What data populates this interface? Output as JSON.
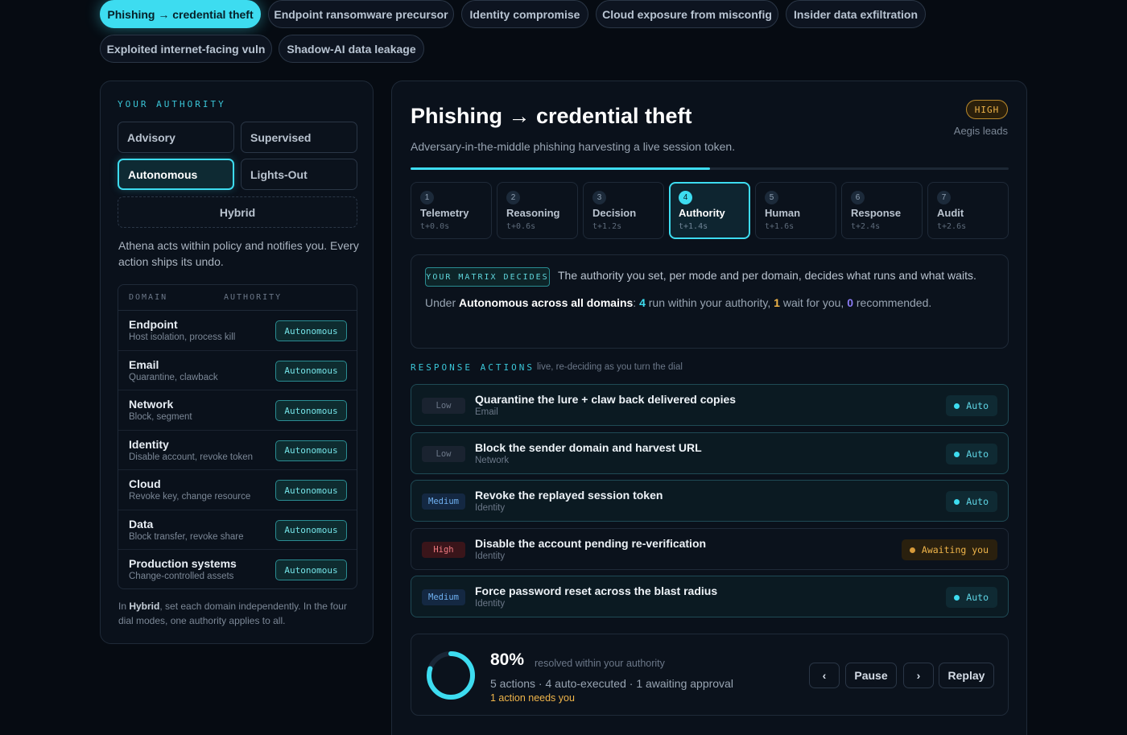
{
  "scenarios": [
    "Phishing → credential theft",
    "Endpoint ransomware precursor",
    "Identity compromise",
    "Cloud exposure from misconfig",
    "Insider data exfiltration",
    "Exploited internet-facing vuln",
    "Shadow-AI data leakage"
  ],
  "authority": {
    "label": "YOUR AUTHORITY",
    "modes": [
      "Advisory",
      "Supervised",
      "Autonomous",
      "Lights-Out",
      "Hybrid"
    ],
    "selected_mode": "Autonomous",
    "description": "Athena acts within policy and notifies you. Every action ships its undo.",
    "table_headers": [
      "DOMAIN",
      "AUTHORITY"
    ],
    "domains": [
      {
        "name": "Endpoint",
        "sub": "Host isolation, process kill",
        "authority": "Autonomous"
      },
      {
        "name": "Email",
        "sub": "Quarantine, clawback",
        "authority": "Autonomous"
      },
      {
        "name": "Network",
        "sub": "Block, segment",
        "authority": "Autonomous"
      },
      {
        "name": "Identity",
        "sub": "Disable account, revoke token",
        "authority": "Autonomous"
      },
      {
        "name": "Cloud",
        "sub": "Revoke key, change resource",
        "authority": "Autonomous"
      },
      {
        "name": "Data",
        "sub": "Block transfer, revoke share",
        "authority": "Autonomous"
      },
      {
        "name": "Production systems",
        "sub": "Change-controlled assets",
        "authority": "Autonomous"
      }
    ],
    "foot_pre": "In ",
    "foot_bold": "Hybrid",
    "foot_post": ", set each domain independently. In the four dial modes, one authority applies to all."
  },
  "incident": {
    "title": "Phishing → credential theft",
    "subtitle": "Adversary-in-the-middle phishing harvesting a live session token.",
    "severity": "HIGH",
    "leads": "Aegis leads",
    "progress": 0.5
  },
  "stages": [
    {
      "num": "1",
      "name": "Telemetry",
      "time": "t+0.0s"
    },
    {
      "num": "2",
      "name": "Reasoning",
      "time": "t+0.6s"
    },
    {
      "num": "3",
      "name": "Decision",
      "time": "t+1.2s"
    },
    {
      "num": "4",
      "name": "Authority",
      "time": "t+1.4s",
      "active": true
    },
    {
      "num": "5",
      "name": "Human",
      "time": "t+1.6s"
    },
    {
      "num": "6",
      "name": "Response",
      "time": "t+2.4s"
    },
    {
      "num": "7",
      "name": "Audit",
      "time": "t+2.6s"
    }
  ],
  "matrix": {
    "tag": "YOUR MATRIX DECIDES",
    "text": "The authority you set, per mode and per domain, decides what runs and what waits.",
    "line_pre": "Under ",
    "line_bold": "Autonomous across all domains",
    "line_colon": ": ",
    "run_count": "4",
    "run_text": " run within your authority, ",
    "wait_count": "1",
    "wait_text": " wait for you, ",
    "rec_count": "0",
    "rec_text": " recommended."
  },
  "response": {
    "label": "RESPONSE ACTIONS",
    "note": "live, re-deciding as you turn the dial",
    "actions": [
      {
        "risk": "Low",
        "title": "Quarantine the lure + claw back delivered copies",
        "domain": "Email",
        "status": "Auto"
      },
      {
        "risk": "Low",
        "title": "Block the sender domain and harvest URL",
        "domain": "Network",
        "status": "Auto"
      },
      {
        "risk": "Medium",
        "title": "Revoke the replayed session token",
        "domain": "Identity",
        "status": "Auto"
      },
      {
        "risk": "High",
        "title": "Disable the account pending re-verification",
        "domain": "Identity",
        "status": "Awaiting you"
      },
      {
        "risk": "Medium",
        "title": "Force password reset across the blast radius",
        "domain": "Identity",
        "status": "Auto"
      }
    ]
  },
  "summary": {
    "percent_value": 0.8,
    "percent": "80%",
    "percent_note": "resolved within your authority",
    "line": "5 actions · 4 auto-executed · 1 awaiting approval",
    "needs": "1 action needs you",
    "prev": "‹",
    "pause": "Pause",
    "next": "›",
    "replay": "Replay"
  },
  "colors": {
    "accent": "#3ddcf0",
    "warning": "#f0b54a",
    "recommend": "#8b7cf6",
    "background": "#060b12"
  }
}
